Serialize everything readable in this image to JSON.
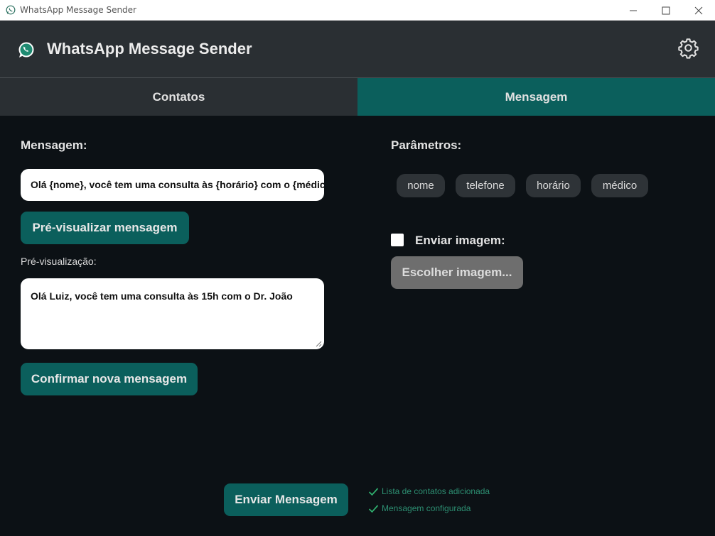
{
  "window": {
    "title": "WhatsApp Message Sender"
  },
  "header": {
    "app_title": "WhatsApp Message Sender"
  },
  "tabs": [
    {
      "label": "Contatos",
      "active": false
    },
    {
      "label": "Mensagem",
      "active": true
    }
  ],
  "message": {
    "label": "Mensagem:",
    "input_value": "Olá {nome}, você tem uma consulta às {horário} com o {médico}",
    "preview_button": "Pré-visualizar mensagem",
    "preview_label": "Pré-visualização:",
    "preview_text": "Olá Luiz, você tem uma consulta às 15h com o Dr. João",
    "confirm_button": "Confirmar nova mensagem"
  },
  "parameters": {
    "label": "Parâmetros:",
    "chips": [
      "nome",
      "telefone",
      "horário",
      "médico"
    ]
  },
  "image": {
    "checkbox_label": "Enviar imagem:",
    "checked": false,
    "choose_button": "Escolher imagem..."
  },
  "footer": {
    "send_button": "Enviar Mensagem",
    "status": [
      "Lista de contatos adicionada",
      "Mensagem configurada"
    ]
  },
  "colors": {
    "accent": "#0b5f5c",
    "background": "#0c1115",
    "header": "#2a2f33",
    "status_ok": "#2d8f72"
  }
}
